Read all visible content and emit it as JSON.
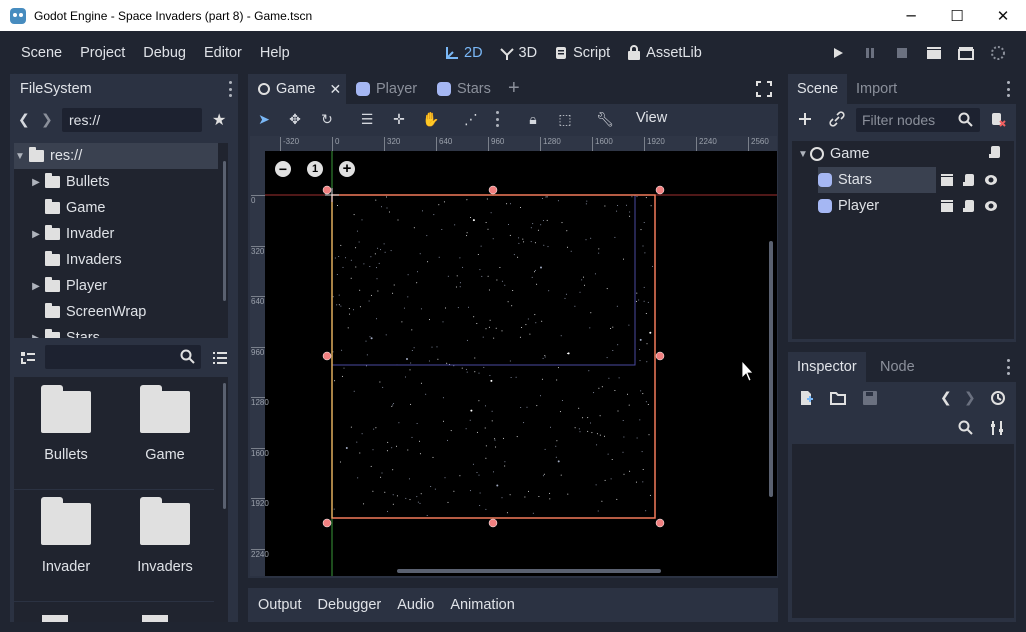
{
  "window": {
    "title": "Godot Engine - Space Invaders (part 8) - Game.tscn",
    "min_glyph": "─",
    "max_glyph": "☐",
    "close_glyph": "✕"
  },
  "menu": {
    "items": [
      "Scene",
      "Project",
      "Debug",
      "Editor",
      "Help"
    ]
  },
  "modes": {
    "m2d": "2D",
    "m3d": "3D",
    "script": "Script",
    "assetlib": "AssetLib"
  },
  "filesystem": {
    "tab": "FileSystem",
    "path": "res://",
    "tree": [
      {
        "label": "res://",
        "arrow": "v",
        "folder": true
      },
      {
        "label": "Bullets",
        "arrow": ">",
        "folder": true
      },
      {
        "label": "Game",
        "arrow": "",
        "folder": true
      },
      {
        "label": "Invader",
        "arrow": ">",
        "folder": true
      },
      {
        "label": "Invaders",
        "arrow": "",
        "folder": true
      },
      {
        "label": "Player",
        "arrow": ">",
        "folder": true
      },
      {
        "label": "ScreenWrap",
        "arrow": "",
        "folder": true
      },
      {
        "label": "Stars",
        "arrow": ">",
        "folder": true
      }
    ],
    "grid": [
      "Bullets",
      "Game",
      "Invader",
      "Invaders"
    ]
  },
  "editor_tabs": {
    "game": "Game",
    "player": "Player",
    "stars": "Stars",
    "close_glyph": "✕",
    "add_glyph": "+"
  },
  "toolbar": {
    "view": "View"
  },
  "zoom": {
    "minus": "−",
    "reset": "1",
    "plus": "+"
  },
  "ruler": {
    "top_labels": [
      "-320",
      "0",
      "320",
      "640",
      "960",
      "1280",
      "1600",
      "1920",
      "2240",
      "2560"
    ],
    "left_labels": [
      "0",
      "320",
      "640",
      "960",
      "1280",
      "1600",
      "1920",
      "2240"
    ]
  },
  "bottom_tabs": [
    "Output",
    "Debugger",
    "Audio",
    "Animation"
  ],
  "scene": {
    "tab": "Scene",
    "import_tab": "Import",
    "filter_placeholder": "Filter nodes",
    "nodes": [
      {
        "label": "Game"
      },
      {
        "label": "Stars"
      },
      {
        "label": "Player"
      }
    ]
  },
  "inspector": {
    "tab": "Inspector",
    "node_tab": "Node"
  },
  "colors": {
    "accent": "#7ab8f7",
    "panel": "#2b3242",
    "background": "#202531",
    "selection_rect": "#f27a5a",
    "handle": "#f08080"
  }
}
